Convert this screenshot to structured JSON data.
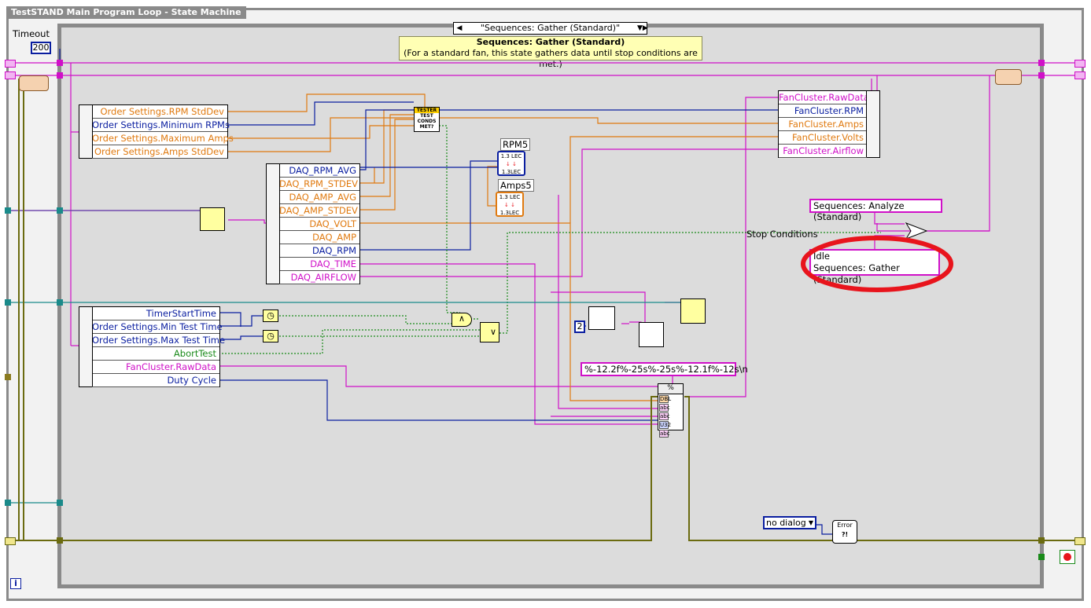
{
  "loop": {
    "title": "TestSTAND Main Program Loop - State Machine"
  },
  "timeout": {
    "label": "Timeout",
    "value": "200"
  },
  "case": {
    "selector": "\"Sequences: Gather (Standard)\""
  },
  "comment": {
    "title": "Sequences: Gather (Standard)",
    "body": "(For a standard fan, this state gathers data until stop conditions are met.)"
  },
  "order_settings": [
    {
      "label": "Order Settings.RPM StdDev",
      "color": "#e07a10"
    },
    {
      "label": "Order Settings.Minimum RPMs",
      "color": "#0a1ea0"
    },
    {
      "label": "Order Settings.Maximum Amps",
      "color": "#e07a10"
    },
    {
      "label": "Order Settings.Amps StdDev",
      "color": "#e07a10"
    }
  ],
  "daq": [
    {
      "label": "DAQ_RPM_AVG",
      "color": "#0a1ea0"
    },
    {
      "label": "DAQ_RPM_STDEV",
      "color": "#e07a10"
    },
    {
      "label": "DAQ_AMP_AVG",
      "color": "#e07a10"
    },
    {
      "label": "DAQ_AMP_STDEV",
      "color": "#e07a10"
    },
    {
      "label": "DAQ_VOLT",
      "color": "#e07a10"
    },
    {
      "label": "DAQ_AMP",
      "color": "#e07a10"
    },
    {
      "label": "DAQ_RPM",
      "color": "#0a1ea0"
    },
    {
      "label": "DAQ_TIME",
      "color": "#d010c8"
    },
    {
      "label": "DAQ_AIRFLOW",
      "color": "#d010c8"
    }
  ],
  "timer": [
    {
      "label": "TimerStartTime",
      "color": "#0a1ea0"
    },
    {
      "label": "Order Settings.Min Test Time",
      "color": "#0a1ea0"
    },
    {
      "label": "Order Settings.Max Test Time",
      "color": "#0a1ea0"
    },
    {
      "label": "AbortTest",
      "color": "#1a8a1a"
    },
    {
      "label": "FanCluster.RawData",
      "color": "#d010c8"
    },
    {
      "label": "Duty Cycle",
      "color": "#0a1ea0"
    }
  ],
  "fancluster": [
    {
      "label": "FanCluster.RawData",
      "color": "#d010c8"
    },
    {
      "label": "FanCluster.RPM",
      "color": "#0a1ea0"
    },
    {
      "label": "FanCluster.Amps",
      "color": "#e07a10"
    },
    {
      "label": "FanCluster.Volts",
      "color": "#e07a10"
    },
    {
      "label": "FanCluster.Airflow",
      "color": "#d010c8"
    }
  ],
  "tester_node": {
    "line1": "TESTER",
    "line2": "TEST",
    "line3": "CONDS",
    "line4": "MET?"
  },
  "rpm5": {
    "label": "RPM5",
    "top": "1.3 LEC",
    "bottom": "1.3LEC"
  },
  "amps5": {
    "label": "Amps5",
    "top": "1.3 LEC",
    "bottom": "1.3LEC"
  },
  "next_state": {
    "analyze": "Sequences: Analyze (Standard)",
    "stop_label": "Stop Conditions"
  },
  "state_options": {
    "line1": "Idle",
    "line2": "Sequences: Gather (Standard)"
  },
  "format_string": "%-12.2f%-25s%-25s%-12.1f%-12s\\n",
  "format_node": {
    "ports": [
      "DBL",
      "abc",
      "abc",
      "U32",
      "abc"
    ]
  },
  "numeric_const": "2",
  "and_node": "∧",
  "or_node": "∨",
  "dialog": {
    "selected": "no dialog"
  },
  "error_node": {
    "label": "Error",
    "sub": "?!"
  },
  "info": "i",
  "annotation_color": "#e8141c"
}
